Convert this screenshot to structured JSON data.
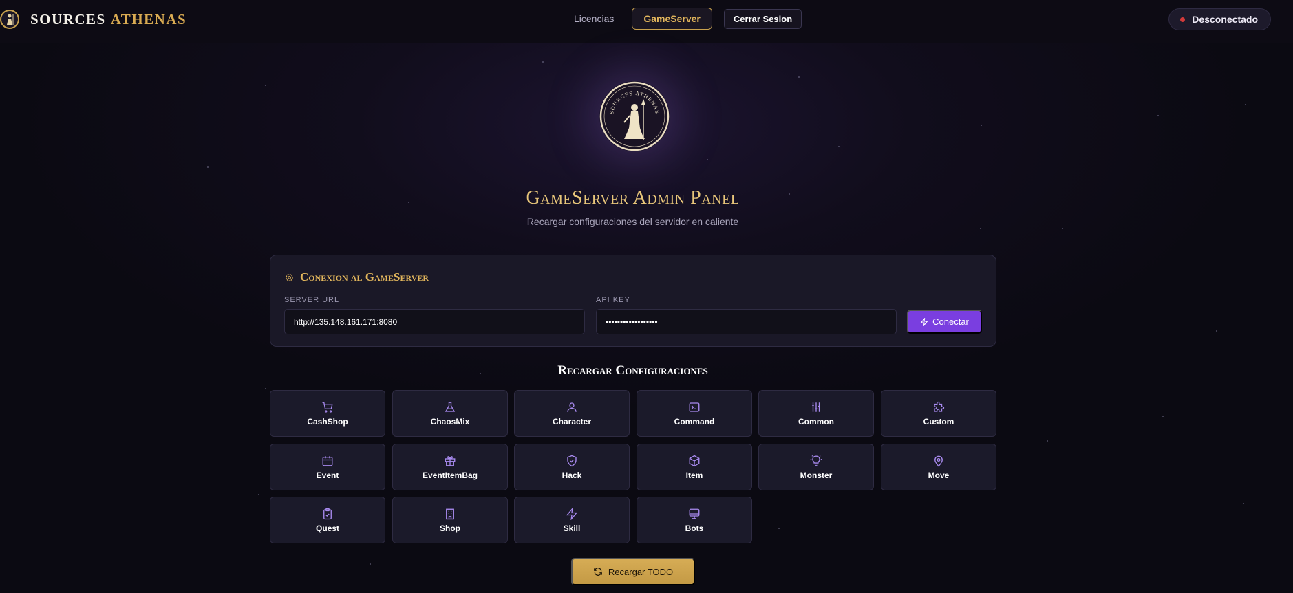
{
  "brand": {
    "name_part1": "SOURCES",
    "name_part2": "ATHENAS",
    "logo_icon": "athena-logo-icon"
  },
  "nav": {
    "link_licencias": "Licencias",
    "link_gameserver": "GameServer",
    "logout_label": "Cerrar Sesion"
  },
  "status": {
    "label": "Desconectado",
    "color": "#d23a3a"
  },
  "hero": {
    "emblem_text": "SOURCES ATHENAS",
    "title": "GameServer Admin Panel",
    "subtitle": "Recargar configuraciones del servidor en caliente"
  },
  "connection": {
    "title": "Conexion al GameServer",
    "server_url_label": "SERVER URL",
    "server_url_value": "http://135.148.161.171:8080",
    "api_key_label": "API KEY",
    "api_key_value": "••••••••••••••••••",
    "connect_label": "Conectar"
  },
  "reload": {
    "section_title": "Recargar Configuraciones",
    "tiles": [
      {
        "label": "CashShop",
        "icon": "cart-icon"
      },
      {
        "label": "ChaosMix",
        "icon": "flask-icon"
      },
      {
        "label": "Character",
        "icon": "user-icon"
      },
      {
        "label": "Command",
        "icon": "terminal-icon"
      },
      {
        "label": "Common",
        "icon": "sliders-icon"
      },
      {
        "label": "Custom",
        "icon": "puzzle-icon"
      },
      {
        "label": "Event",
        "icon": "calendar-icon"
      },
      {
        "label": "EventItemBag",
        "icon": "gift-icon"
      },
      {
        "label": "Hack",
        "icon": "shield-icon"
      },
      {
        "label": "Item",
        "icon": "box-icon"
      },
      {
        "label": "Monster",
        "icon": "bulb-icon"
      },
      {
        "label": "Move",
        "icon": "map-pin-icon"
      },
      {
        "label": "Quest",
        "icon": "clipboard-icon"
      },
      {
        "label": "Shop",
        "icon": "building-icon"
      },
      {
        "label": "Skill",
        "icon": "zap-icon"
      },
      {
        "label": "Bots",
        "icon": "monitor-icon"
      }
    ],
    "reload_all_label": "Recargar TODO"
  },
  "colors": {
    "accent_gold": "#d9ab52",
    "accent_purple": "#7a3ee0",
    "icon_purple": "#a98bf0"
  }
}
